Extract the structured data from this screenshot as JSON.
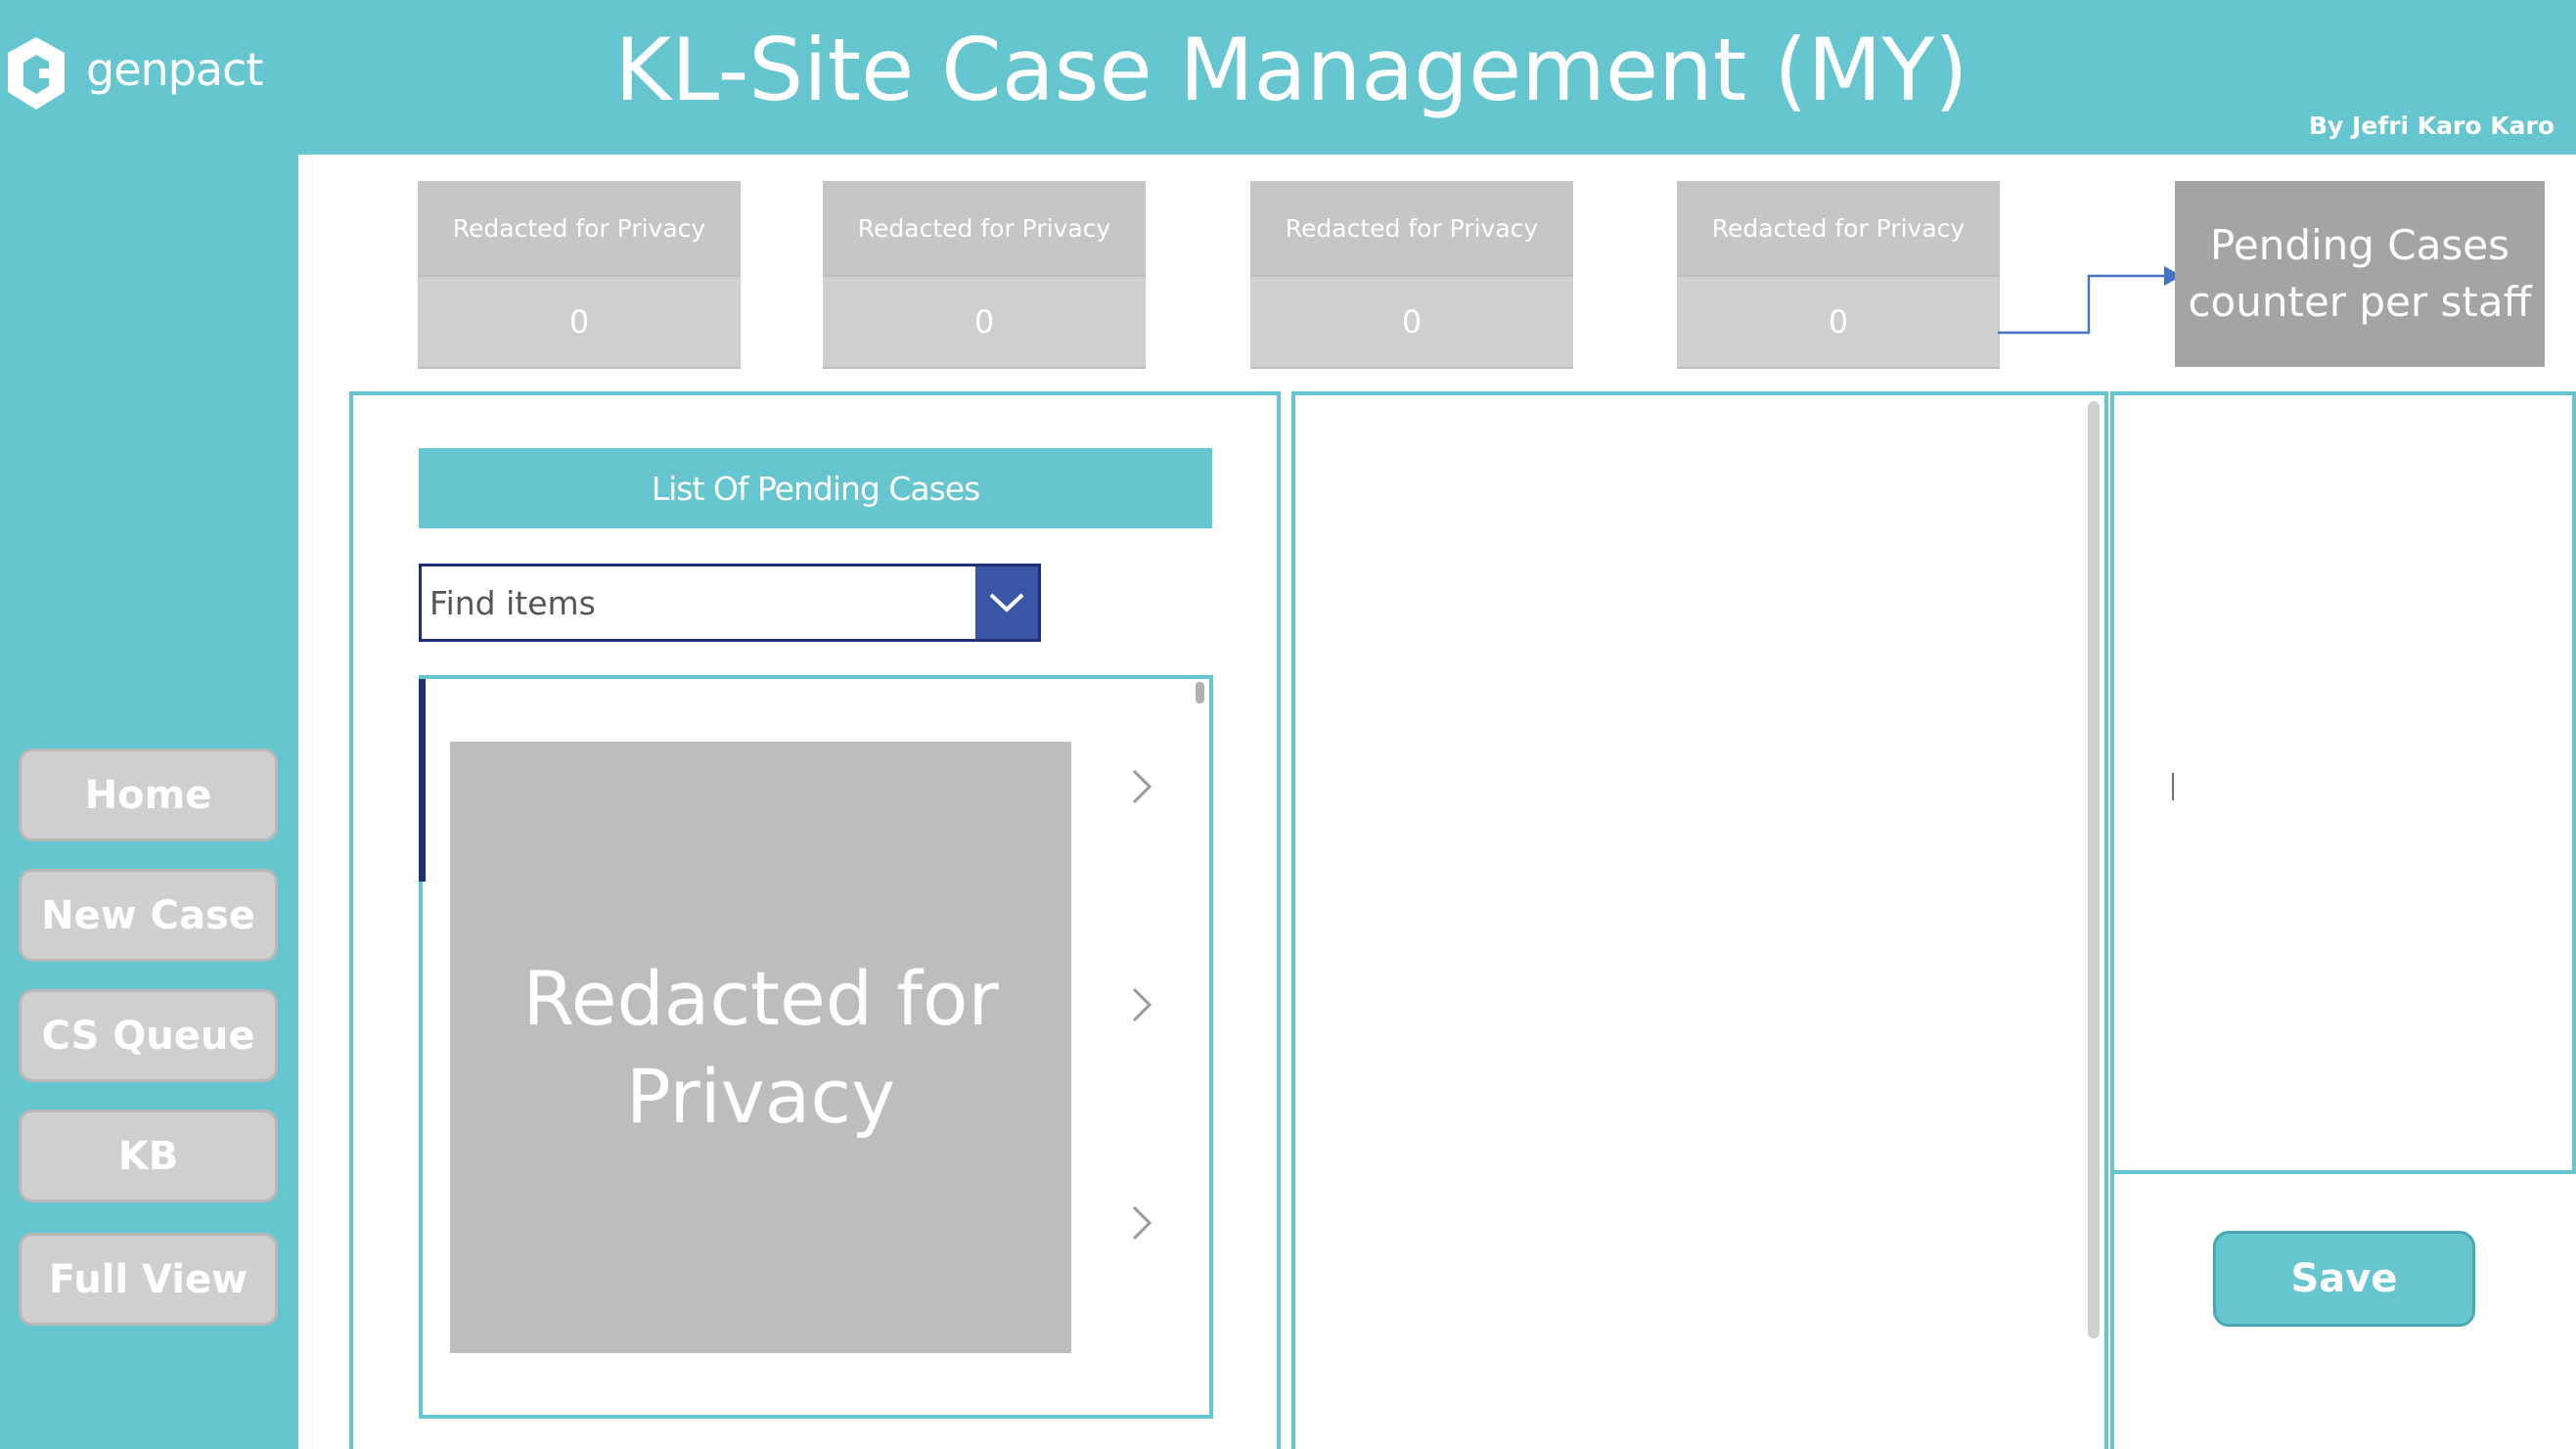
{
  "header": {
    "brand": "genpact",
    "title": "KL-Site Case Management (MY)",
    "author": "By Jefri Karo Karo"
  },
  "sidebar": {
    "items": [
      {
        "label": "Home"
      },
      {
        "label": "New Case"
      },
      {
        "label": "CS Queue"
      },
      {
        "label": "KB"
      },
      {
        "label": "Full View"
      }
    ]
  },
  "stats": [
    {
      "label": "Redacted for Privacy",
      "value": "0"
    },
    {
      "label": "Redacted for Privacy",
      "value": "0"
    },
    {
      "label": "Redacted for Privacy",
      "value": "0"
    },
    {
      "label": "Redacted for Privacy",
      "value": "0"
    }
  ],
  "callout": {
    "text": "Pending Cases counter per staff"
  },
  "list": {
    "heading": "List Of Pending Cases",
    "search_placeholder": "Find items",
    "redacted_text": "Redacted for Privacy"
  },
  "actions": {
    "save_label": "Save"
  },
  "colors": {
    "teal": "#66c6d0",
    "navy": "#1f2f78",
    "dropdown_blue": "#3a56a6",
    "tile_gray": "#c6c6c6",
    "callout_gray": "#a4a4a4",
    "arrow_blue": "#4472c4"
  }
}
